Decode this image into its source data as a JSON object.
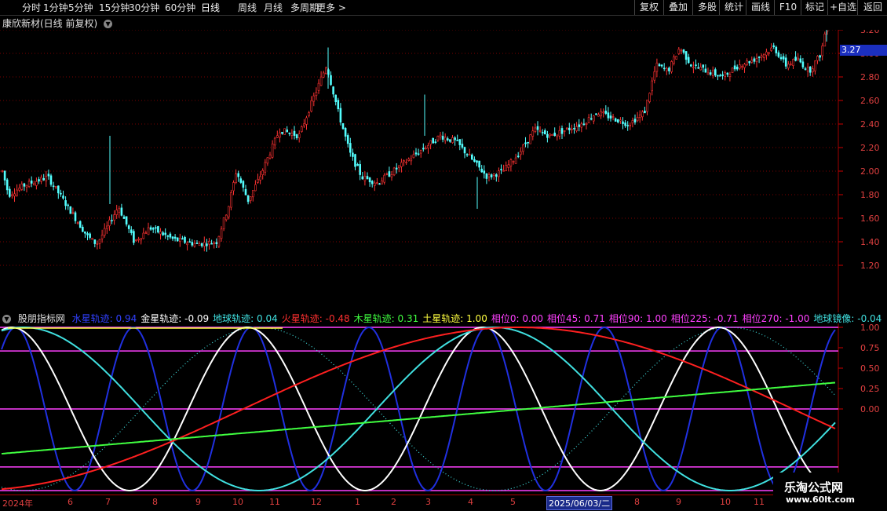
{
  "toolbar": {
    "periods": [
      "分时",
      "1分钟",
      "5分钟",
      "15分钟",
      "30分钟",
      "60分钟",
      "日线",
      "周线",
      "月线",
      "多周期",
      "更多 >"
    ],
    "active_period": "日线",
    "right_buttons": [
      "复权",
      "叠加",
      "多股",
      "统计",
      "画线",
      "F10",
      "标记",
      "+自选",
      "返回"
    ]
  },
  "stock": {
    "title": "康欣新材(日线 前复权)",
    "current_price": "3.27"
  },
  "price_axis": [
    "3.40",
    "3.20",
    "3.00",
    "2.80",
    "2.60",
    "2.40",
    "2.20",
    "2.00",
    "1.80",
    "1.60",
    "1.40",
    "1.20"
  ],
  "indicator": {
    "name": "股朋指标网",
    "items": [
      {
        "label": "水星轨迹: 0.94",
        "color": "#3040ff"
      },
      {
        "label": "金星轨迹: -0.09",
        "color": "#ffffff"
      },
      {
        "label": "地球轨迹: 0.04",
        "color": "#40e0e0"
      },
      {
        "label": "火星轨迹: -0.48",
        "color": "#ff3030"
      },
      {
        "label": "木星轨迹: 0.31",
        "color": "#40ff40"
      },
      {
        "label": "土星轨迹: 1.00",
        "color": "#ffff40"
      },
      {
        "label": "相位0: 0.00",
        "color": "#ff40ff"
      },
      {
        "label": "相位45: 0.71",
        "color": "#ff40ff"
      },
      {
        "label": "相位90: 1.00",
        "color": "#ff40ff"
      },
      {
        "label": "相位225: -0.71",
        "color": "#ff40ff"
      },
      {
        "label": "相位270: -1.00",
        "color": "#ff40ff"
      },
      {
        "label": "地球镜像: -0.04",
        "color": "#40e0e0"
      }
    ],
    "axis": [
      "1.00",
      "0.75",
      "0.50",
      "0.25",
      "0.00"
    ]
  },
  "date_axis": {
    "ticks": [
      "2024年",
      "6",
      "7",
      "8",
      "9",
      "10",
      "11",
      "12",
      "1",
      "2",
      "3",
      "4",
      "5",
      "8",
      "9",
      "10",
      "11"
    ],
    "cursor_label": "2025/06/03/二"
  },
  "watermark": {
    "line1": "乐淘公式网",
    "line2": "www.60lt.com"
  },
  "colors": {
    "up": "#ff3232",
    "down": "#54ffff",
    "grid": "#7a0000",
    "mercury": "#2030e0",
    "venus": "#ffffff",
    "earth": "#40e0e0",
    "mars": "#ff2020",
    "jupiter": "#40ff40",
    "phase": "#ff40ff"
  }
}
